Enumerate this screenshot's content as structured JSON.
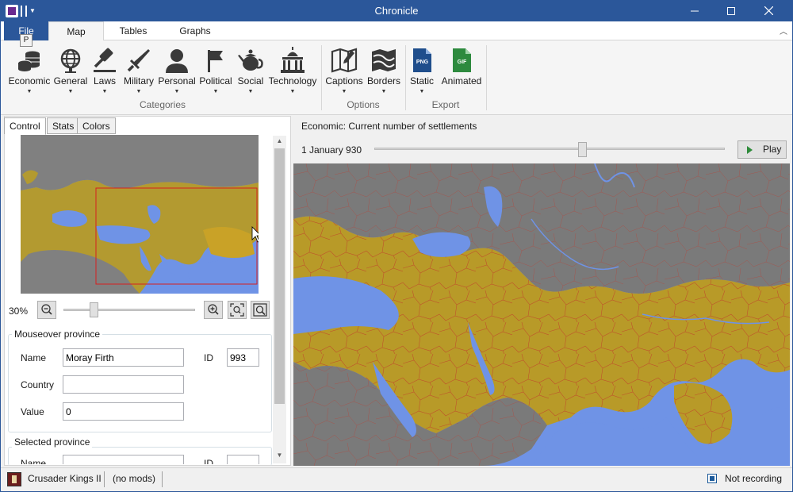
{
  "window": {
    "title": "Chronicle"
  },
  "ribbon_tabs": [
    {
      "label": "File",
      "keytip": "P"
    },
    {
      "label": "Map"
    },
    {
      "label": "Tables"
    },
    {
      "label": "Graphs"
    }
  ],
  "ribbon": {
    "categories": {
      "label": "Categories",
      "buttons": [
        "Economic",
        "General",
        "Laws",
        "Military",
        "Personal",
        "Political",
        "Social",
        "Technology"
      ]
    },
    "options": {
      "label": "Options",
      "buttons": [
        "Captions",
        "Borders"
      ]
    },
    "export": {
      "label": "Export",
      "buttons": [
        "Static",
        "Animated"
      ],
      "png_tag": "PNG",
      "gif_tag": "GIF"
    }
  },
  "left_tabs": [
    "Control",
    "Stats",
    "Colors"
  ],
  "zoom": {
    "percent_label": "30%",
    "level": 0.3
  },
  "mouseover": {
    "title": "Mouseover province",
    "name_label": "Name",
    "name_value": "Moray Firth",
    "id_label": "ID",
    "id_value": "993",
    "country_label": "Country",
    "country_value": "",
    "value_label": "Value",
    "value_value": "0"
  },
  "selected": {
    "title": "Selected province",
    "name_label": "Name",
    "id_label": "ID"
  },
  "main": {
    "stat_title": "Economic: Current number of settlements",
    "date": "1 January 930",
    "play_label": "Play"
  },
  "status": {
    "game": "Crusader Kings II",
    "mods": "(no mods)",
    "recording": "Not recording"
  },
  "colors": {
    "accent": "#2b579a",
    "ocean": "#6f93e6",
    "province_gold": "#b89a28",
    "province_gray": "#7a7a7a",
    "border_red": "#c0392b"
  }
}
